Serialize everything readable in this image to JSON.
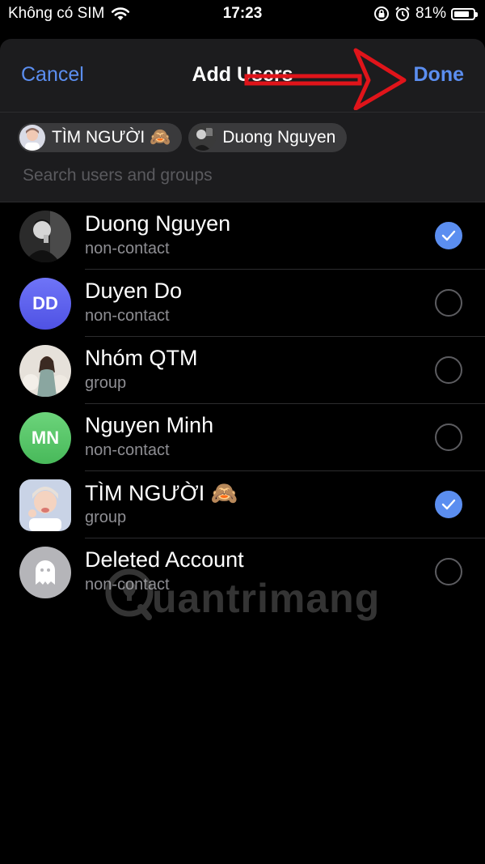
{
  "status_bar": {
    "carrier": "Không có SIM",
    "time": "17:23",
    "battery": "81%",
    "battery_level": 0.81
  },
  "nav": {
    "cancel_label": "Cancel",
    "title": "Add Users",
    "done_label": "Done"
  },
  "selected_chips": [
    {
      "label": "TÌM NGƯỜI 🙈"
    },
    {
      "label": "Duong Nguyen"
    }
  ],
  "search": {
    "placeholder": "Search users and groups",
    "value": ""
  },
  "users": [
    {
      "name": "Duong Nguyen",
      "subtitle": "non-contact",
      "selected": true,
      "avatar": "photo"
    },
    {
      "name": "Duyen Do",
      "subtitle": "non-contact",
      "selected": false,
      "avatar": "initials",
      "initials": "DD",
      "color": "#5f63f2"
    },
    {
      "name": "Nhóm QTM",
      "subtitle": "group",
      "selected": false,
      "avatar": "photo"
    },
    {
      "name": "Nguyen Minh",
      "subtitle": "non-contact",
      "selected": false,
      "avatar": "initials",
      "initials": "MN",
      "color": "#56c466"
    },
    {
      "name": "TÌM NGƯỜI 🙈",
      "subtitle": "group",
      "selected": true,
      "avatar": "photo"
    },
    {
      "name": "Deleted Account",
      "subtitle": "non-contact",
      "selected": false,
      "avatar": "ghost-icon",
      "color": "#b5b5b9"
    }
  ],
  "watermark": {
    "text": "uantrimang"
  },
  "colors": {
    "accent": "#5b8ef0",
    "arrow": "#e0141a"
  }
}
